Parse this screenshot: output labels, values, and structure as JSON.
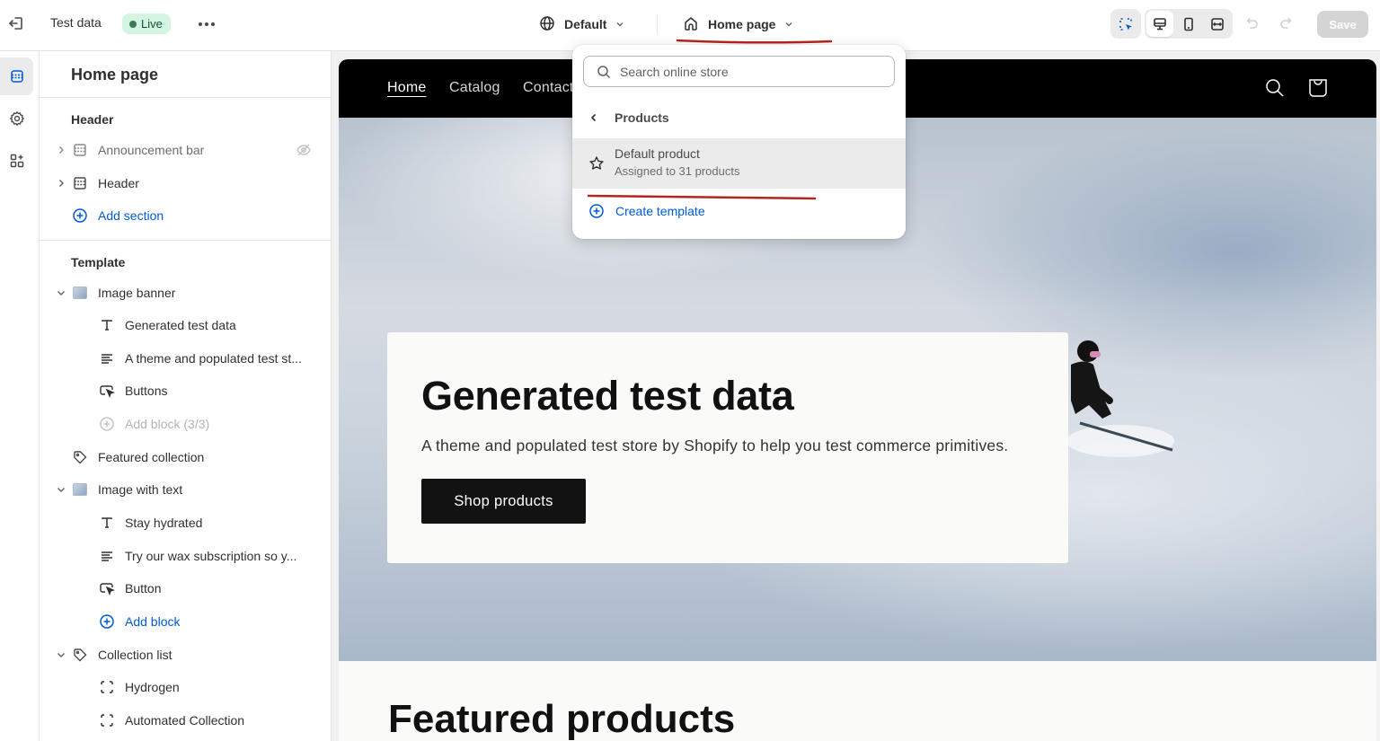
{
  "topbar": {
    "exit_icon": "exit-icon",
    "store_name": "Test data",
    "status_badge": "Live",
    "more_icon": "more-horizontal-icon",
    "theme_selector": {
      "icon": "globe-icon",
      "label": "Default"
    },
    "page_selector": {
      "icon": "home-icon",
      "label": "Home page"
    },
    "tools": {
      "inspector": "inspector-icon",
      "devices": [
        "desktop",
        "mobile",
        "fullscreen"
      ],
      "active_device": "desktop"
    },
    "save_label": "Save",
    "accent_color": "#005bd3"
  },
  "rail": {
    "items": [
      {
        "name": "sections",
        "icon": "sections-icon",
        "active": true
      },
      {
        "name": "theme-settings",
        "icon": "gear-icon",
        "active": false
      },
      {
        "name": "apps",
        "icon": "apps-add-icon",
        "active": false
      }
    ]
  },
  "sidebar": {
    "title": "Home page",
    "header_group": {
      "label": "Header",
      "items": [
        {
          "label": "Announcement bar",
          "hidden": true
        },
        {
          "label": "Header",
          "hidden": false
        }
      ],
      "add_label": "Add section"
    },
    "template_group": {
      "label": "Template",
      "sections": [
        {
          "label": "Image banner",
          "expanded": true,
          "blocks": [
            {
              "icon": "text-icon",
              "label": "Generated test data"
            },
            {
              "icon": "paragraph-icon",
              "label": "A theme and populated test st..."
            },
            {
              "icon": "button-icon",
              "label": "Buttons"
            }
          ],
          "add_label": "Add block (3/3)",
          "add_disabled": true
        },
        {
          "label": "Featured collection",
          "expanded": false
        },
        {
          "label": "Image with text",
          "expanded": true,
          "blocks": [
            {
              "icon": "text-icon",
              "label": "Stay hydrated"
            },
            {
              "icon": "paragraph-icon",
              "label": "Try our wax subscription so y..."
            },
            {
              "icon": "button-icon",
              "label": "Button"
            }
          ],
          "add_label": "Add block",
          "add_disabled": false
        },
        {
          "label": "Collection list",
          "expanded": true,
          "blocks": [
            {
              "icon": "collection-icon",
              "label": "Hydrogen"
            },
            {
              "icon": "collection-icon",
              "label": "Automated Collection"
            }
          ]
        }
      ]
    }
  },
  "dropdown": {
    "search_placeholder": "Search online store",
    "back_label": "Products",
    "templates": [
      {
        "label": "Default product",
        "sublabel": "Assigned to 31 products",
        "default": true
      }
    ],
    "create_label": "Create template"
  },
  "preview": {
    "nav": [
      "Home",
      "Catalog",
      "Contact"
    ],
    "active_nav": "Home",
    "hero": {
      "title": "Generated test data",
      "subtitle": "A theme and populated test store by Shopify to help you test commerce primitives.",
      "button": "Shop products"
    },
    "featured_title": "Featured products"
  },
  "annotations": {
    "underline_color": "#b3261e"
  }
}
